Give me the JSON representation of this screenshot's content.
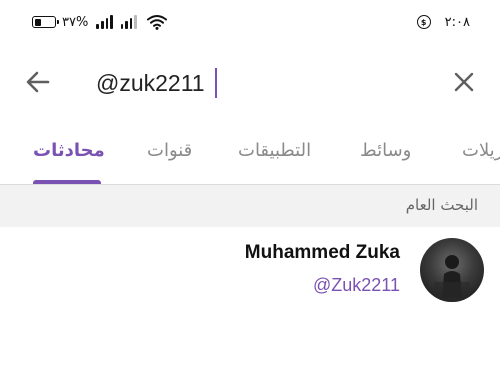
{
  "status_bar": {
    "battery_percent": "%٣٧",
    "battery_level": 0.37,
    "time": "٢:٠٨",
    "icons": [
      "battery-icon",
      "signal-icon",
      "signal-icon",
      "wifi-icon",
      "data-saver-icon"
    ]
  },
  "search": {
    "value": "@zuk2211",
    "back_icon": "arrow-left-icon",
    "clear_icon": "close-icon"
  },
  "tabs": [
    {
      "label": "محادثات",
      "active": true
    },
    {
      "label": "قنوات",
      "active": false
    },
    {
      "label": "التطبيقات",
      "active": false
    },
    {
      "label": "وسائط",
      "active": false
    },
    {
      "label": "تنزيلات",
      "active": false
    }
  ],
  "section": {
    "title": "البحث العام"
  },
  "results": [
    {
      "name": "Muhammed Zuka",
      "username": "@Zuk2211",
      "avatar_icon": "user-photo"
    }
  ],
  "colors": {
    "accent": "#7a52b3",
    "tab_inactive": "#8a8a8a",
    "section_bg": "#f2f2f2"
  }
}
